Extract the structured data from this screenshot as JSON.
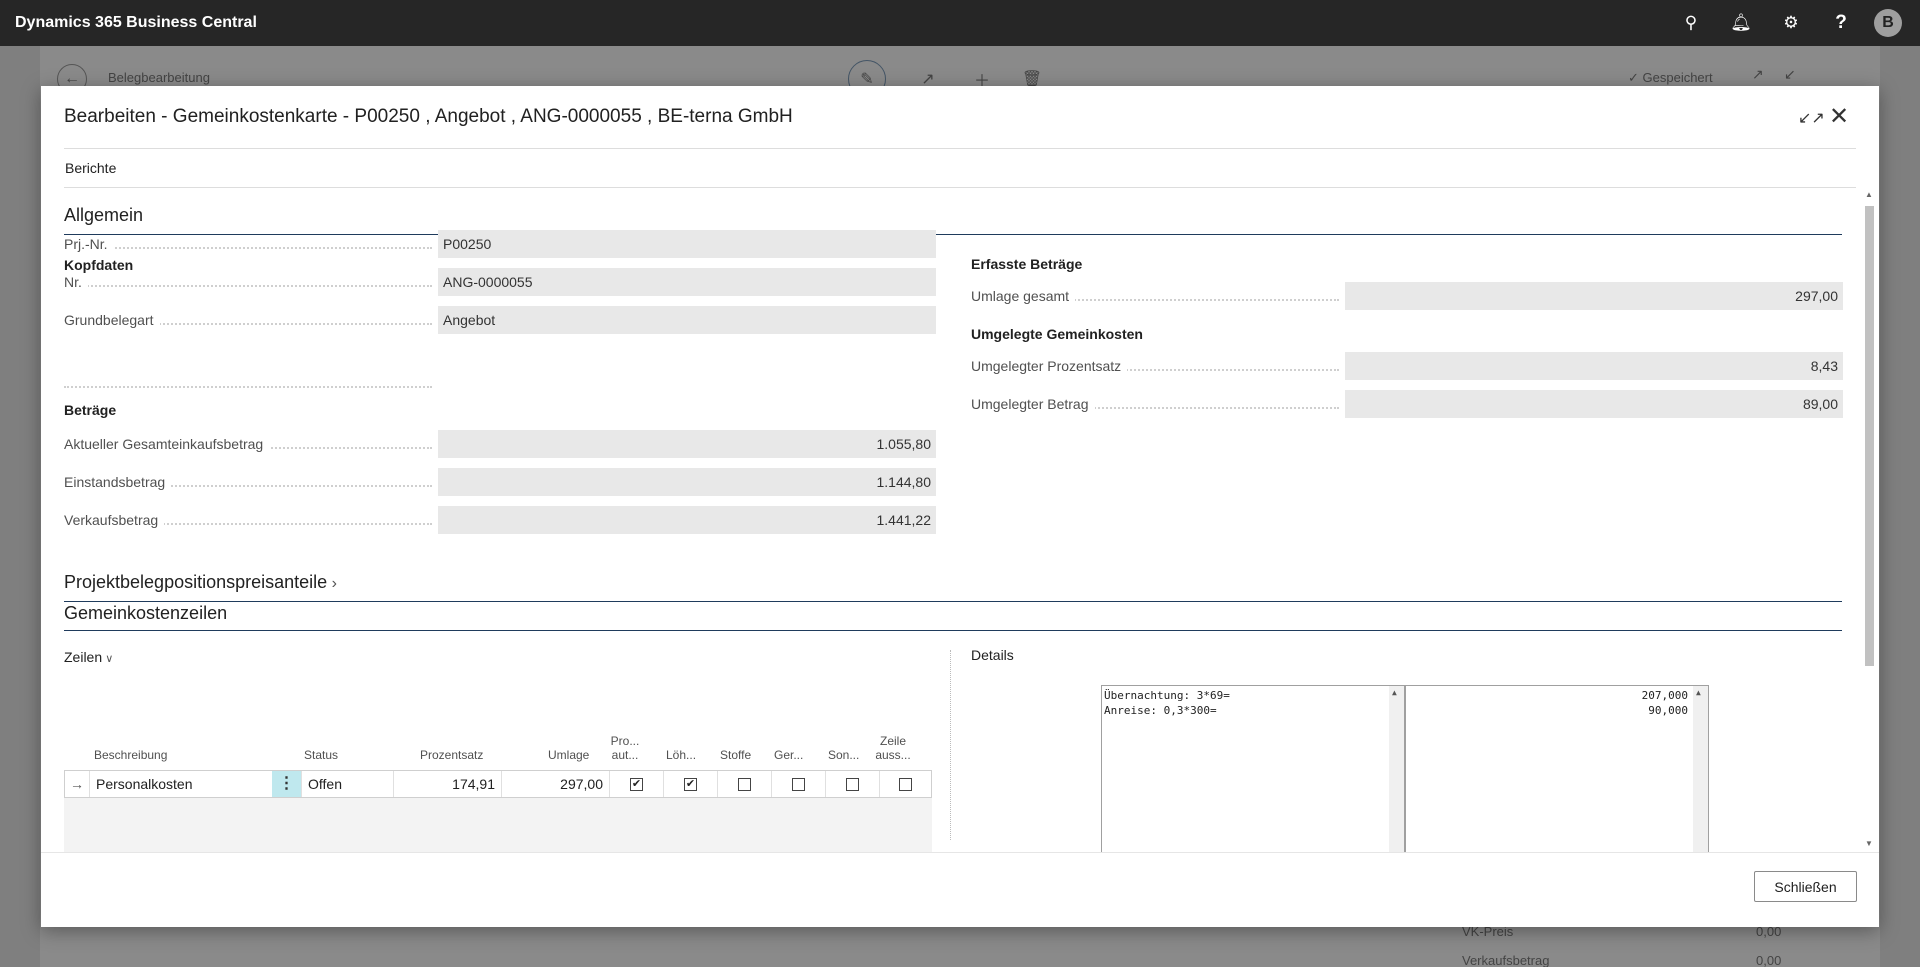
{
  "app": {
    "title": "Dynamics 365 Business Central",
    "avatar_initial": "B"
  },
  "background_page": {
    "title": "Belegbearbeitung",
    "saved_label": "Gespeichert",
    "bottom_rows": [
      {
        "label": "VK-Preis",
        "value": "0,00"
      },
      {
        "label": "Verkaufsbetrag",
        "value": "0,00"
      }
    ]
  },
  "dialog": {
    "title": "Bearbeiten - Gemeinkostenkarte - P00250 , Angebot , ANG-0000055 , BE-terna GmbH",
    "menu_item": "Berichte",
    "close_label": "Schließen"
  },
  "allgemein": {
    "title": "Allgemein",
    "kopfdaten": {
      "title": "Kopfdaten",
      "fields": [
        {
          "label": "Prj.-Nr.",
          "value": "P00250"
        },
        {
          "label": "Nr.",
          "value": "ANG-0000055"
        },
        {
          "label": "Grundbelegart",
          "value": "Angebot"
        }
      ]
    },
    "betraege": {
      "title": "Beträge",
      "fields": [
        {
          "label": "Aktueller Gesamteinkaufsbetrag",
          "value": "1.055,80"
        },
        {
          "label": "Einstandsbetrag",
          "value": "1.144,80"
        },
        {
          "label": "Verkaufsbetrag",
          "value": "1.441,22"
        }
      ]
    },
    "erfasste": {
      "title": "Erfasste Beträge",
      "fields": [
        {
          "label": "Umlage gesamt",
          "value": "297,00"
        }
      ]
    },
    "umgelegte": {
      "title": "Umgelegte Gemeinkosten",
      "fields": [
        {
          "label": "Umgelegter Prozentsatz",
          "value": "8,43"
        },
        {
          "label": "Umgelegter Betrag",
          "value": "89,00"
        }
      ]
    }
  },
  "preisanteile": {
    "title": "Projektbelegpositionspreisanteile"
  },
  "gemeinkostenzeilen": {
    "title": "Gemeinkostenzeilen",
    "lines_label": "Zeilen",
    "details_label": "Details",
    "columns": {
      "beschreibung": "Beschreibung",
      "status": "Status",
      "prozentsatz": "Prozentsatz",
      "umlage": "Umlage",
      "pro_aut_1": "Pro...",
      "pro_aut_2": "aut...",
      "loeh": "Löh...",
      "stoffe": "Stoffe",
      "ger": "Ger...",
      "son": "Son...",
      "zeile_1": "Zeile",
      "zeile_2": "auss..."
    },
    "row": {
      "beschreibung": "Personalkosten",
      "status": "Offen",
      "prozentsatz": "174,91",
      "umlage": "297,00",
      "pro_aut": true,
      "loeh": true,
      "stoffe": false,
      "ger": false,
      "son": false,
      "zeile": false
    },
    "details_left": "Übernachtung: 3*69=\nAnreise: 0,3*300=",
    "details_right": "207,000\n90,000"
  }
}
